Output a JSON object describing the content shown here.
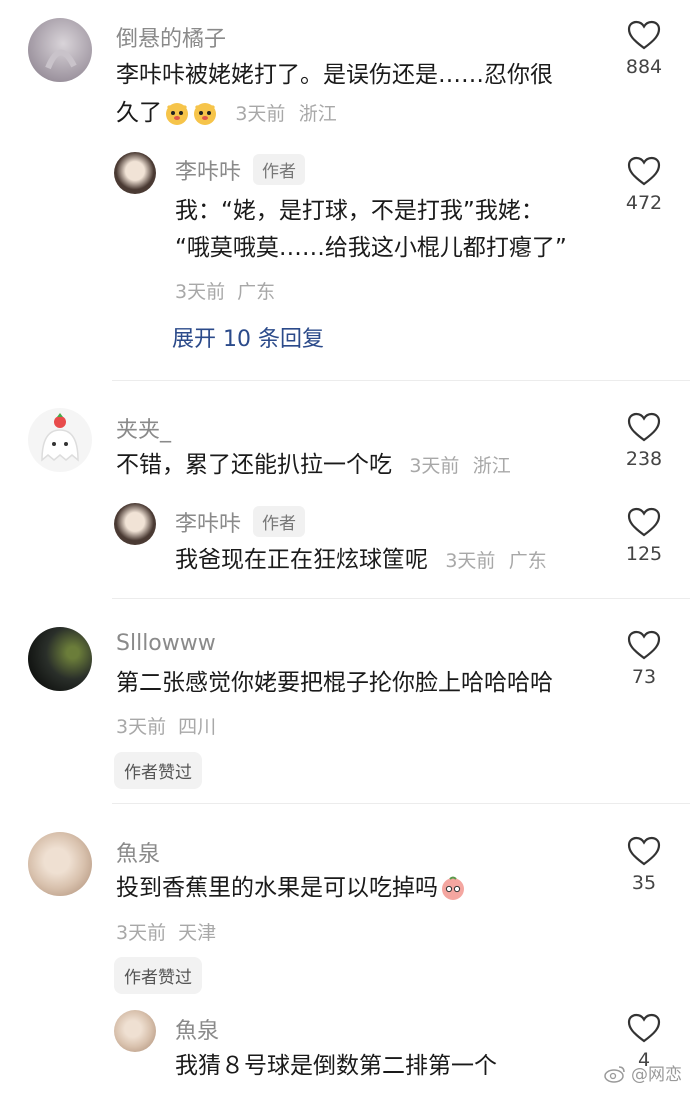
{
  "comments": [
    {
      "user": "倒悬的橘子",
      "text_line1": "李咔咔被姥姥打了。是误伤还是……忍你很",
      "text_line2": "久了",
      "time": "3天前",
      "location": "浙江",
      "likes": "884",
      "reply": {
        "user": "李咔咔",
        "badge": "作者",
        "text_line1": "我：“姥，是打球，不是打我”我姥：",
        "text_line2": "“哦莫哦莫……给我这小棍儿都打瘪了”",
        "time": "3天前",
        "location": "广东",
        "likes": "472"
      },
      "expand_label": "展开 10 条回复"
    },
    {
      "user": "夹夹_",
      "text": "不错，累了还能扒拉一个吃",
      "time": "3天前",
      "location": "浙江",
      "likes": "238",
      "reply": {
        "user": "李咔咔",
        "badge": "作者",
        "text": "我爸现在正在狂炫球筐呢",
        "time": "3天前",
        "location": "广东",
        "likes": "125"
      }
    },
    {
      "user": "Slllowww",
      "text": "第二张感觉你姥要把棍子抡你脸上哈哈哈哈",
      "time": "3天前",
      "location": "四川",
      "likes": "73",
      "tag": "作者赞过"
    },
    {
      "user": "魚泉",
      "text": "投到香蕉里的水果是可以吃掉吗",
      "time": "3天前",
      "location": "天津",
      "likes": "35",
      "tag": "作者赞过",
      "reply": {
        "user": "魚泉",
        "text": "我猜８号球是倒数第二排第一个",
        "likes": "4"
      }
    }
  ],
  "watermark": "@网恋",
  "colors": {
    "accent_link": "#2b4a8a",
    "meta_gray": "#a8a8a8"
  },
  "icons": [
    "heart-outline-icon",
    "weibo-icon"
  ]
}
